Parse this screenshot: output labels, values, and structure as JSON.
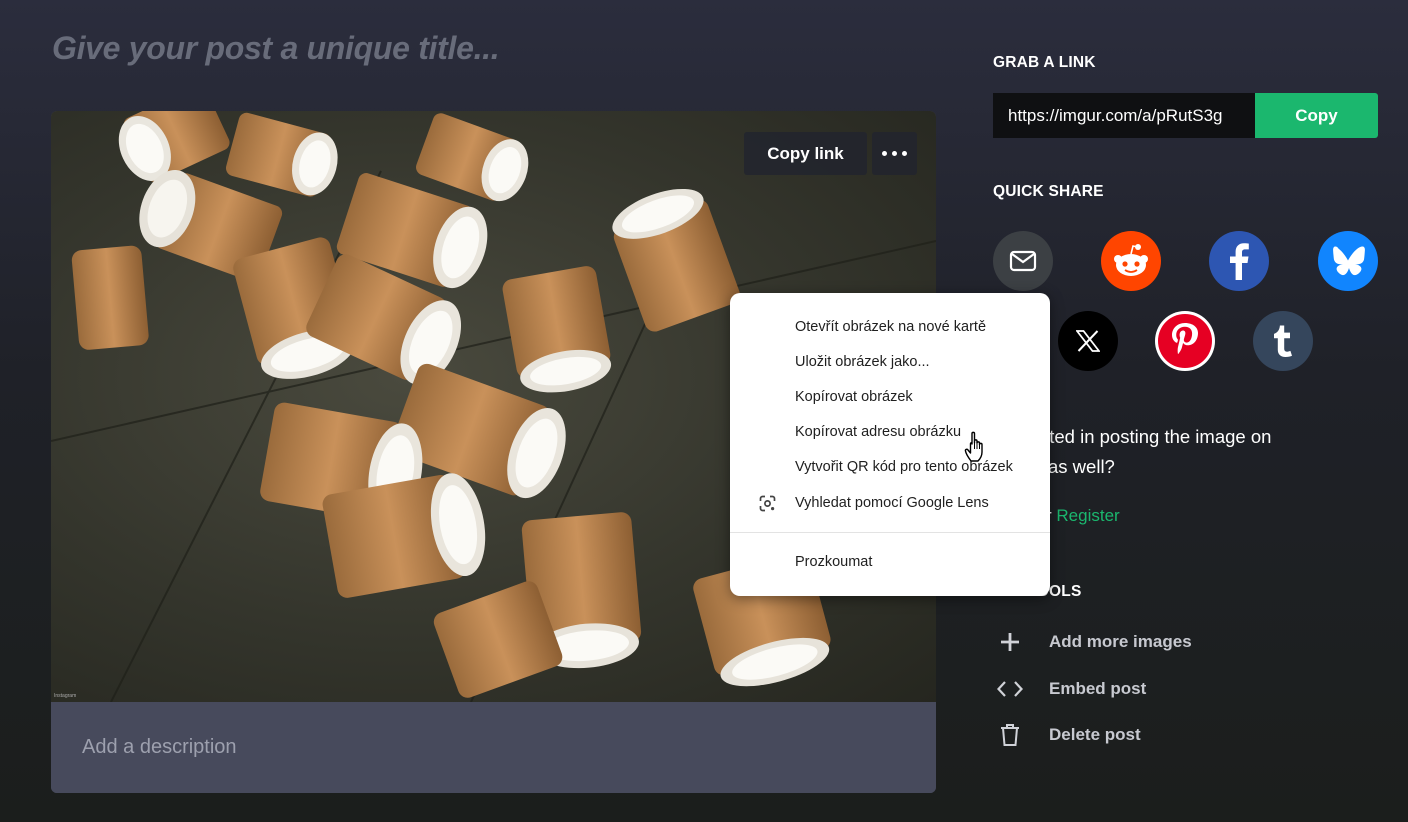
{
  "post": {
    "title_placeholder": "Give your post a unique title...",
    "description_placeholder": "Add a description",
    "image_overlay": {
      "copy_link_label": "Copy link",
      "more_icon": "more-dots-icon"
    },
    "photo_credit": "Instagram"
  },
  "grab_link": {
    "heading": "GRAB A LINK",
    "url": "https://imgur.com/a/pRutS3g",
    "copy_label": "Copy"
  },
  "quick_share": {
    "heading": "QUICK SHARE",
    "services": [
      {
        "name": "email",
        "icon": "mail-icon",
        "color": "#3c4044"
      },
      {
        "name": "reddit",
        "icon": "reddit-icon",
        "color": "#ff4500"
      },
      {
        "name": "facebook",
        "icon": "facebook-icon",
        "color": "#2d56b2"
      },
      {
        "name": "bluesky",
        "icon": "bluesky-icon",
        "color": "#1185fe"
      },
      {
        "name": "x",
        "icon": "x-icon",
        "color": "#000000"
      },
      {
        "name": "pinterest",
        "icon": "pinterest-icon",
        "color": "#e60023"
      },
      {
        "name": "tumblr",
        "icon": "tumblr-icon",
        "color": "#35465c"
      }
    ]
  },
  "community": {
    "line1": "sted in posting the image on",
    "line2": "as well?",
    "prefix": "r",
    "register_label": "Register"
  },
  "tools": {
    "heading": "IMG TOOLS",
    "items": [
      {
        "label": "Add more images",
        "icon": "plus-icon"
      },
      {
        "label": "Embed post",
        "icon": "code-icon"
      },
      {
        "label": "Delete post",
        "icon": "trash-icon"
      }
    ]
  },
  "context_menu": {
    "items": [
      "Otevřít obrázek na nové kartě",
      "Uložit obrázek jako...",
      "Kopírovat obrázek",
      "Kopírovat adresu obrázku",
      "Vytvořit QR kód pro tento obrázek",
      "Vyhledat pomocí Google Lens",
      "Prozkoumat"
    ]
  },
  "colors": {
    "accent": "#1bb76e",
    "description_bg": "#474a5c",
    "title_placeholder": "#686c7a"
  }
}
